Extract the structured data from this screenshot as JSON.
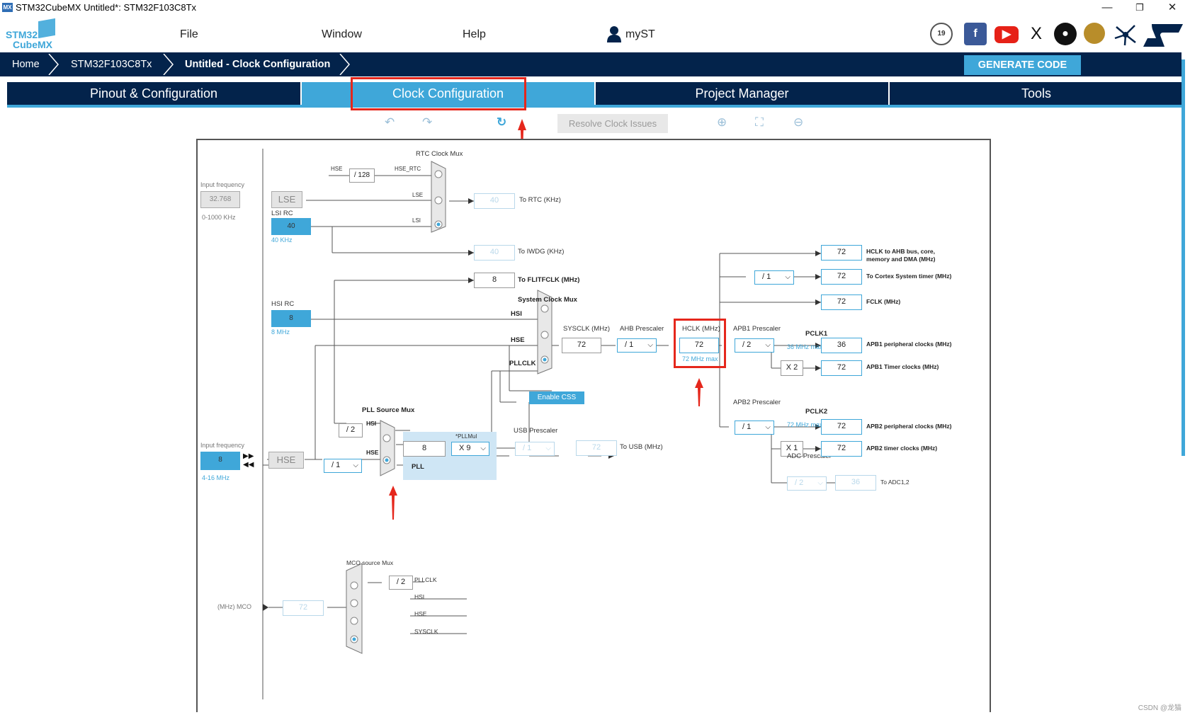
{
  "window": {
    "title": "STM32CubeMX Untitled*: STM32F103C8Tx",
    "app_icon": "MX",
    "minimize": "—",
    "restore": "❐",
    "close": "✕"
  },
  "logo": {
    "line1": "STM32",
    "line2": "CubeMX"
  },
  "menu": {
    "file": "File",
    "window": "Window",
    "help": "Help",
    "myst": "myST"
  },
  "social": {
    "fb": "f",
    "x": "X",
    "st": "ST"
  },
  "breadcrumb": {
    "home": "Home",
    "mcu": "STM32F103C8Tx",
    "project": "Untitled - Clock Configuration"
  },
  "generate": "GENERATE CODE",
  "tabs": {
    "pinout": "Pinout & Configuration",
    "clock": "Clock Configuration",
    "project": "Project Manager",
    "tools": "Tools"
  },
  "toolbar": {
    "undo": "↶",
    "redo": "↷",
    "refresh": "↻",
    "resolve": "Resolve Clock Issues",
    "zoom_in": "⊕",
    "fit": "⛶",
    "zoom_out": "⊖"
  },
  "diagram": {
    "rtc_mux": "RTC Clock Mux",
    "hse_in": "HSE",
    "div128": "/ 128",
    "hse_rtc": "HSE_RTC",
    "input_freq_lbl": "Input frequency",
    "lse_freq": "32.768",
    "lse_range": "0-1000 KHz",
    "lse": "LSE",
    "lse_sig": "LSE",
    "lsi_rc": "LSI RC",
    "lsi_val": "40",
    "lsi_khz": "40 KHz",
    "lsi_sig": "LSI",
    "rtc_out": "40",
    "rtc_lbl": "To RTC (KHz)",
    "iwdg_out": "40",
    "iwdg_lbl": "To IWDG (KHz)",
    "flit_out": "8",
    "flit_lbl": "To FLITFCLK (MHz)",
    "sys_mux": "System Clock Mux",
    "hsi_rc": "HSI RC",
    "hsi_val": "8",
    "hsi_mhz": "8 MHz",
    "sig_hsi": "HSI",
    "sig_hse": "HSE",
    "sig_pllclk": "PLLCLK",
    "sysclk_lbl": "SYSCLK (MHz)",
    "sysclk": "72",
    "ahb_lbl": "AHB Prescaler",
    "ahb": "/ 1",
    "hclk_lbl": "HCLK (MHz)",
    "hclk": "72",
    "hclk_max": "72 MHz max",
    "enable_css": "Enable CSS",
    "apb1_lbl": "APB1 Prescaler",
    "apb1": "/ 2",
    "pclk1": "PCLK1",
    "pclk1_max": "36 MHz max",
    "x2": "X 2",
    "apb2_lbl": "APB2 Prescaler",
    "apb2": "/ 1",
    "pclk2": "PCLK2",
    "pclk2_max": "72 MHz max",
    "x1": "X 1",
    "adc_lbl": "ADC Prescaler",
    "adc": "/ 2",
    "cortex_div": "/ 1",
    "out_hclk": "72",
    "out_hclk_lbl": "HCLK to AHB bus, core, memory and DMA (MHz)",
    "out_cortex": "72",
    "out_cortex_lbl": "To Cortex System timer (MHz)",
    "out_fclk": "72",
    "out_fclk_lbl": "FCLK (MHz)",
    "out_apb1p": "36",
    "out_apb1p_lbl": "APB1 peripheral clocks (MHz)",
    "out_apb1t": "72",
    "out_apb1t_lbl": "APB1 Timer clocks (MHz)",
    "out_apb2p": "72",
    "out_apb2p_lbl": "APB2 peripheral clocks (MHz)",
    "out_apb2t": "72",
    "out_apb2t_lbl": "APB2 timer clocks (MHz)",
    "out_adc": "36",
    "out_adc_lbl": "To ADC1,2",
    "pll_src": "PLL Source Mux",
    "div2": "/ 2",
    "pll_hsi": "HSI",
    "pll_hse": "HSE",
    "hse_freq": "8",
    "hse_range": "4-16 MHz",
    "hse": "HSE",
    "hse_div": "/ 1",
    "pll_in": "8",
    "pllmul_lbl": "*PLLMul",
    "pllmul": "X 9",
    "pll": "PLL",
    "usb_lbl": "USB Prescaler",
    "usb_div": "/ 1",
    "usb_out": "72",
    "usb_out_lbl": "To USB (MHz)",
    "mco_mux": "MCO source Mux",
    "mco_div": "/ 2",
    "mco_pllclk": "PLLCLK",
    "mco_hsi": "HSI",
    "mco_hse": "HSE",
    "mco_sysclk": "SYSCLK",
    "mco_lbl": "(MHz) MCO",
    "mco_out": "72"
  },
  "watermark": "CSDN @龙猫"
}
